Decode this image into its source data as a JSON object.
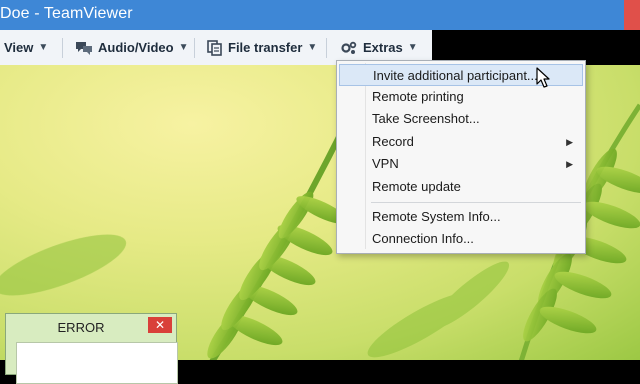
{
  "window": {
    "title": "Doe - TeamViewer"
  },
  "toolbar": {
    "view_label": "View",
    "audio_video_label": "Audio/Video",
    "file_transfer_label": "File transfer",
    "extras_label": "Extras",
    "icons": [
      "audio-video-icon",
      "file-transfer-icon",
      "extras-icon"
    ]
  },
  "extras_menu": {
    "items": [
      {
        "label": "Invite additional participant...",
        "highlighted": true
      },
      {
        "label": "Remote printing"
      },
      {
        "label": "Take Screenshot..."
      },
      {
        "label": "Record",
        "submenu": true
      },
      {
        "label": "VPN",
        "submenu": true
      },
      {
        "label": "Remote update"
      },
      {
        "label": "Remote System Info..."
      },
      {
        "label": "Connection Info..."
      }
    ]
  },
  "error_dialog": {
    "title": "ERROR",
    "close_glyph": "✕"
  },
  "colors": {
    "titlebar": "#3e87d6",
    "menu_highlight": "#dbe8f7",
    "error_close": "#d9403a"
  }
}
